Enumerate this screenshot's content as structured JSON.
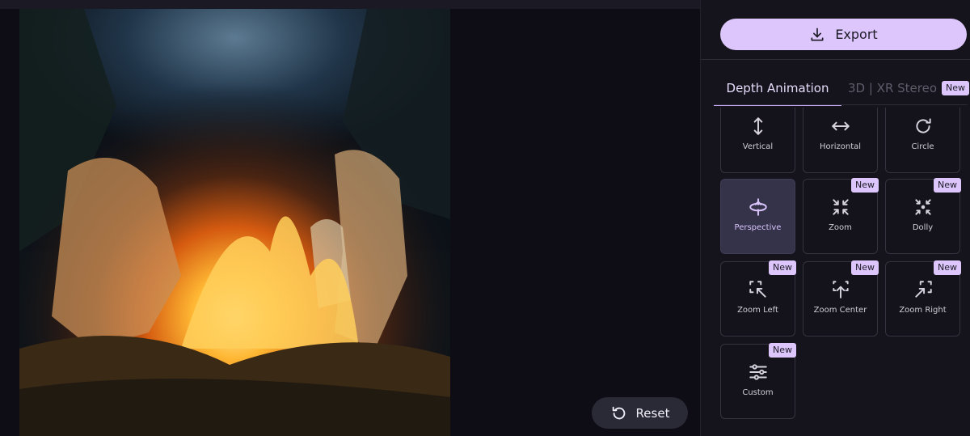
{
  "toolbar": {
    "export_label": "Export",
    "reset_label": "Reset"
  },
  "tabs": [
    {
      "label": "Depth Animation",
      "active": true
    },
    {
      "label": "3D | XR Stereo",
      "badge": "New",
      "active": false
    }
  ],
  "animations": [
    {
      "label": "Vertical",
      "icon": "vertical-arrows-icon",
      "badge": "",
      "active": false
    },
    {
      "label": "Horizontal",
      "icon": "horizontal-arrows-icon",
      "badge": "",
      "active": false
    },
    {
      "label": "Circle",
      "icon": "circle-arrow-icon",
      "badge": "",
      "active": false
    },
    {
      "label": "Perspective",
      "icon": "perspective-icon",
      "badge": "",
      "active": true
    },
    {
      "label": "Zoom",
      "icon": "zoom-icon",
      "badge": "New",
      "active": false
    },
    {
      "label": "Dolly",
      "icon": "dolly-icon",
      "badge": "New",
      "active": false
    },
    {
      "label": "Zoom Left",
      "icon": "zoom-left-icon",
      "badge": "New",
      "active": false
    },
    {
      "label": "Zoom Center",
      "icon": "zoom-center-icon",
      "badge": "New",
      "active": false
    },
    {
      "label": "Zoom Right",
      "icon": "zoom-right-icon",
      "badge": "New",
      "active": false
    },
    {
      "label": "Custom",
      "icon": "sliders-icon",
      "badge": "New",
      "active": false
    }
  ],
  "colors": {
    "accent": "#dcc6fb",
    "active_card": "#34334a",
    "panel_bg": "#15141d"
  }
}
